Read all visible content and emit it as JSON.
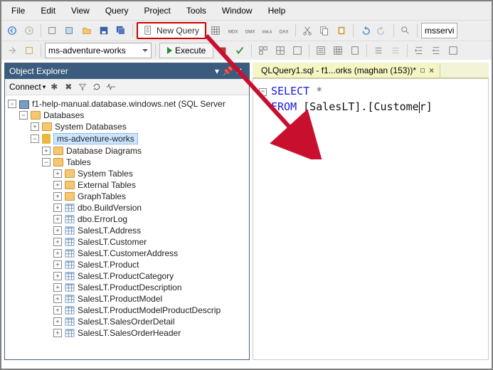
{
  "menu": [
    "File",
    "Edit",
    "View",
    "Query",
    "Project",
    "Tools",
    "Window",
    "Help"
  ],
  "toolbar1": {
    "new_query_label": "New Query",
    "right_input_placeholder": "msservi"
  },
  "toolbar2": {
    "dropdown_value": "ms-adventure-works",
    "execute_label": "Execute"
  },
  "object_explorer": {
    "title": "Object Explorer",
    "connect_label": "Connect",
    "server_label": "f1-help-manual.database.windows.net (SQL Server ",
    "databases_label": "Databases",
    "system_databases_label": "System Databases",
    "selected_db_label": "ms-adventure-works",
    "db_diagrams_label": "Database Diagrams",
    "tables_label": "Tables",
    "system_tables_label": "System Tables",
    "external_tables_label": "External Tables",
    "graph_tables_label": "GraphTables",
    "table_items": [
      "dbo.BuildVersion",
      "dbo.ErrorLog",
      "SalesLT.Address",
      "SalesLT.Customer",
      "SalesLT.CustomerAddress",
      "SalesLT.Product",
      "SalesLT.ProductCategory",
      "SalesLT.ProductDescription",
      "SalesLT.ProductModel",
      "SalesLT.ProductModelProductDescrip",
      "SalesLT.SalesOrderDetail",
      "SalesLT.SalesOrderHeader"
    ]
  },
  "editor": {
    "tab_label": "QLQuery1.sql - f1...orks (maghan (153))*",
    "kw_select": "SELECT",
    "star": "*",
    "kw_from": "FROM",
    "obj_text_before": "[SalesLT].[Custome",
    "obj_text_after": "r]"
  }
}
